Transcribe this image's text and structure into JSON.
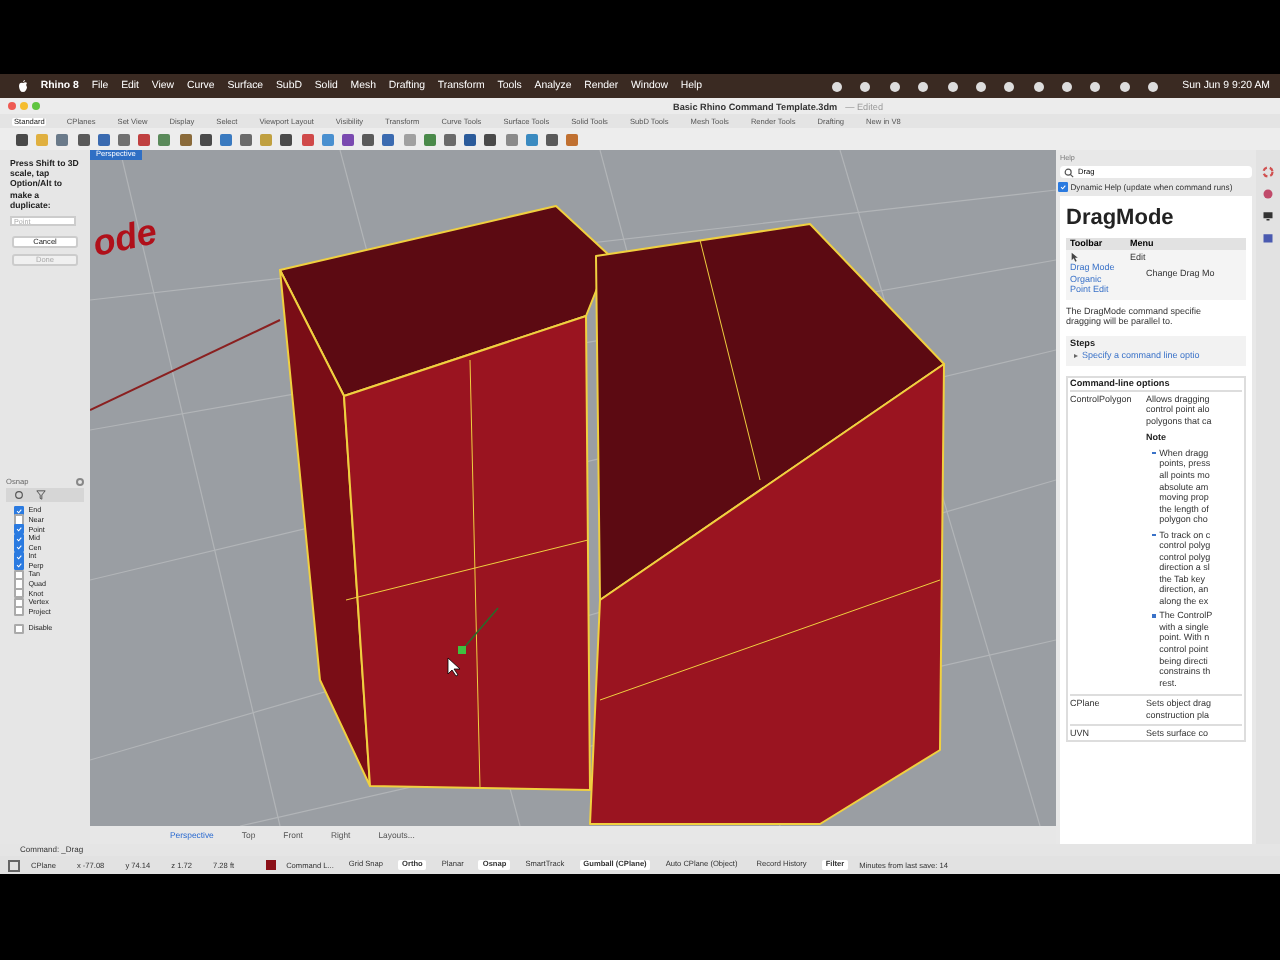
{
  "menu_bar": {
    "app": "Rhino 8",
    "items": [
      "File",
      "Edit",
      "View",
      "Curve",
      "Surface",
      "SubD",
      "Solid",
      "Mesh",
      "Drafting",
      "Transform",
      "Tools",
      "Analyze",
      "Render",
      "Window",
      "Help"
    ],
    "clock": "Sun Jun 9 9:20 AM"
  },
  "window": {
    "title": "Basic Rhino Command Template.3dm",
    "status": "— Edited"
  },
  "toolbar_tabs": [
    {
      "label": "Standard",
      "selected": true
    },
    {
      "label": "CPlanes",
      "selected": false
    },
    {
      "label": "Set View",
      "selected": false
    },
    {
      "label": "Display",
      "selected": false
    },
    {
      "label": "Select",
      "selected": false
    },
    {
      "label": "Viewport Layout",
      "selected": false
    },
    {
      "label": "Visibility",
      "selected": false
    },
    {
      "label": "Transform",
      "selected": false
    },
    {
      "label": "Curve Tools",
      "selected": false
    },
    {
      "label": "Surface Tools",
      "selected": false
    },
    {
      "label": "Solid Tools",
      "selected": false
    },
    {
      "label": "SubD Tools",
      "selected": false
    },
    {
      "label": "Mesh Tools",
      "selected": false
    },
    {
      "label": "Render Tools",
      "selected": false
    },
    {
      "label": "Drafting",
      "selected": false
    },
    {
      "label": "New in V8",
      "selected": false
    }
  ],
  "command_prompt": {
    "message": "Press Shift to 3D scale, tap Option/Alt to make a duplicate:",
    "placeholder": "Point",
    "buttons": [
      {
        "label": "Cancel",
        "disabled": false
      },
      {
        "label": "Done",
        "disabled": true
      }
    ]
  },
  "osnap": {
    "title": "Osnap",
    "items": [
      {
        "label": "End",
        "checked": true
      },
      {
        "label": "Near",
        "checked": false
      },
      {
        "label": "Point",
        "checked": true
      },
      {
        "label": "Mid",
        "checked": true
      },
      {
        "label": "Cen",
        "checked": true
      },
      {
        "label": "Int",
        "checked": true
      },
      {
        "label": "Perp",
        "checked": true
      },
      {
        "label": "Tan",
        "checked": false
      },
      {
        "label": "Quad",
        "checked": false
      },
      {
        "label": "Knot",
        "checked": false
      },
      {
        "label": "Vertex",
        "checked": false
      },
      {
        "label": "Project",
        "checked": false
      }
    ],
    "disable": {
      "label": "Disable",
      "checked": false
    }
  },
  "viewport": {
    "title": "Perspective",
    "background_text": "ode"
  },
  "viewport_tabs": [
    {
      "label": "Perspective",
      "selected": true
    },
    {
      "label": "Top",
      "selected": false
    },
    {
      "label": "Front",
      "selected": false
    },
    {
      "label": "Right",
      "selected": false
    },
    {
      "label": "Layouts...",
      "selected": false
    }
  ],
  "command_line": "Command: _Drag",
  "status_bar": {
    "cplane": "CPlane",
    "coordinates": [
      "x -77.08",
      "y 74.14",
      "z 1.72"
    ],
    "distance": "7.28 ft",
    "layer": {
      "name": "Command L...",
      "color": "#8b1018"
    },
    "toggles": [
      {
        "label": "Grid Snap",
        "on": false
      },
      {
        "label": "Ortho",
        "on": true
      },
      {
        "label": "Planar",
        "on": false
      },
      {
        "label": "Osnap",
        "on": true
      },
      {
        "label": "SmartTrack",
        "on": false
      },
      {
        "label": "Gumball (CPlane)",
        "on": true
      },
      {
        "label": "Auto CPlane (Object)",
        "on": false
      },
      {
        "label": "Record History",
        "on": false
      },
      {
        "label": "Filter",
        "on": true
      }
    ],
    "message": "Minutes from last save: 14"
  },
  "help": {
    "title": "Help",
    "search": "Drag",
    "dynamic_help": {
      "label": "Dynamic Help (update when command runs)",
      "checked": true
    },
    "heading": "DragMode",
    "toolbar_header": "Toolbar",
    "menu_header": "Menu",
    "menu_path": "Edit",
    "menu_item": "Change Drag Mo",
    "toolbar_links": [
      "Drag Mode",
      "Organic",
      "Point Edit"
    ],
    "intro": "The DragMode command specifie\ndragging will be parallel to.",
    "steps_title": "Steps",
    "steps": [
      "Specify a command line optio"
    ],
    "options_title": "Command-line options",
    "options": [
      {
        "name": "ControlPolygon",
        "description": "Allows dragging\ncontrol point alo\npolygons that ca",
        "note_title": "Note",
        "notes": [
          "When dragg\npoints, press\nall points mo\nabsolute am\nmoving prop\nthe length of\npolygon cho",
          "To track on c\ncontrol polyg\ncontrol polyg\ndirection a sl\nthe Tab key\ndirection, an\nalong the ex",
          "The ControlP\nwith a single\npoint. With n\ncontrol point\nbeing directi\nconstrains th\nrest."
        ]
      },
      {
        "name": "CPlane",
        "description": "Sets object drag\nconstruction pla"
      },
      {
        "name": "UVN",
        "description": "Sets surface co"
      }
    ]
  }
}
